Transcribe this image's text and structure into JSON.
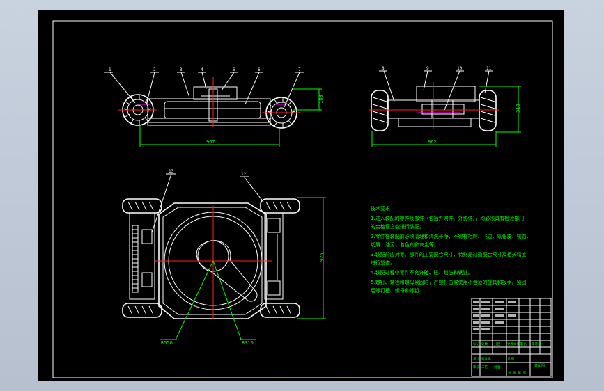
{
  "drawing": {
    "front_view": {
      "callouts": [
        "1",
        "2",
        "3",
        "4",
        "5",
        "6",
        "7"
      ],
      "dim_width": "967",
      "dim_height": "180"
    },
    "side_view": {
      "callouts": [
        "8",
        "9",
        "10",
        "11"
      ],
      "dim_width": "962",
      "dim_height": "310"
    },
    "top_view": {
      "callouts": [
        "12",
        "13"
      ],
      "dim_length": "926",
      "dim_radius_outer": "R550",
      "dim_radius_inner": "R310"
    },
    "tech_notes": {
      "title": "技术要求",
      "lines": [
        "1.进入装配的零件及部件（包括外购件、外协件），均必须具有检验部门",
        "的合格证方能进行装配。",
        "2.零件在装配前必须清理和清洗干净，不得有毛刺、飞边、氧化皮、锈蚀、",
        "切屑、油污、着色剂和灰尘等。",
        "3.装配前应对零、部件的主要配合尺寸，特别是过盈配合尺寸及相关精度",
        "进行复查。",
        "4.装配过程中零件不允许磕、碰、划伤和锈蚀。",
        "5.螺钉、螺栓和螺母紧固时，严禁打击或使用不合适的旋具和扳手。紧固",
        "后螺钉槽、螺母和螺钉、"
      ]
    },
    "title_block": {
      "drawing_name": "装配图",
      "row_labels": [
        "标记",
        "处数",
        "分区",
        "更改文件号",
        "签名",
        "年月日"
      ],
      "footer_labels": [
        "设计",
        "标准化",
        "审核",
        "工艺",
        "批准"
      ],
      "scale_label": "比例",
      "sheet_label": "共 张 第 张"
    }
  }
}
